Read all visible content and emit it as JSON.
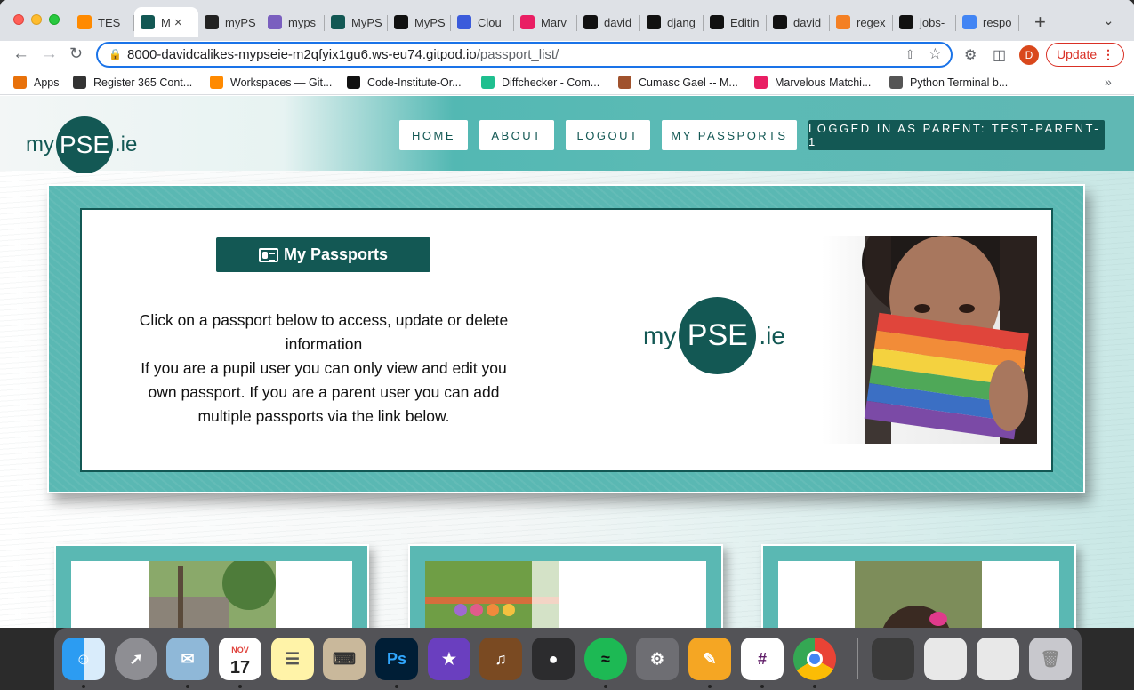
{
  "browser": {
    "tabs": [
      {
        "label": "TES",
        "favicon": "gitpod-icon",
        "color": "#ff8a00"
      },
      {
        "label": "M",
        "favicon": "mypse-icon",
        "color": "#135854",
        "active": true
      },
      {
        "label": "myPS",
        "favicon": "app-icon",
        "color": "#222"
      },
      {
        "label": "myps",
        "favicon": "heroku-icon",
        "color": "#7a5fbf"
      },
      {
        "label": "MyPS",
        "favicon": "mypse-icon",
        "color": "#135854"
      },
      {
        "label": "MyPS",
        "favicon": "github-icon",
        "color": "#111"
      },
      {
        "label": "Clou",
        "favicon": "cloud-icon",
        "color": "#3b5bdb"
      },
      {
        "label": "Marv",
        "favicon": "marvel-icon",
        "color": "#e91e63"
      },
      {
        "label": "david",
        "favicon": "github-icon",
        "color": "#111"
      },
      {
        "label": "djang",
        "favicon": "github-icon",
        "color": "#111"
      },
      {
        "label": "Editin",
        "favicon": "github-icon",
        "color": "#111"
      },
      {
        "label": "david",
        "favicon": "github-icon",
        "color": "#111"
      },
      {
        "label": "regex",
        "favicon": "stackoverflow-icon",
        "color": "#f48024"
      },
      {
        "label": "jobs-",
        "favicon": "github-icon",
        "color": "#111"
      },
      {
        "label": "respo",
        "favicon": "google-icon",
        "color": "#4285f4"
      }
    ],
    "url_host": "8000-davidcalikes-mypseie-m2qfyix1gu6.ws-eu74.gitpod.io",
    "url_path": "/passport_list/",
    "avatar_letter": "D",
    "update_label": "Update",
    "bookmarks": [
      {
        "label": "Apps",
        "icon": "apps-grid-icon",
        "color": "#e8710a"
      },
      {
        "label": "Register 365 Cont...",
        "icon": "register-icon",
        "color": "#333"
      },
      {
        "label": "Workspaces — Git...",
        "icon": "gitpod-icon",
        "color": "#ff8a00"
      },
      {
        "label": "Code-Institute-Or...",
        "icon": "github-icon",
        "color": "#111"
      },
      {
        "label": "Diffchecker - Com...",
        "icon": "diffchecker-icon",
        "color": "#1fbf8f"
      },
      {
        "label": "Cumasc Gael -- M...",
        "icon": "banjo-icon",
        "color": "#a0522d"
      },
      {
        "label": "Marvelous Matchi...",
        "icon": "marvel-icon",
        "color": "#e91e63"
      },
      {
        "label": "Python Terminal b...",
        "icon": "globe-icon",
        "color": "#555"
      }
    ]
  },
  "site": {
    "logo": {
      "pre": "my",
      "mid": "PSE",
      "post": ".ie"
    },
    "nav": [
      "HOME",
      "ABOUT",
      "LOGOUT",
      "MY PASSPORTS"
    ],
    "logged_in": "LOGGED IN AS PARENT: TEST-PARENT-1",
    "hero": {
      "button_label": "My Passports",
      "intro_line1": "Click on a passport below to access, update or delete information",
      "intro_line2": "If you are a pupil user you can only view and edit you own passport. If you are a parent user you can add multiple passports via the link below."
    }
  },
  "colors": {
    "brand": "#135854",
    "teal": "#5ab8b3"
  },
  "dock": {
    "calendar_month": "NOV",
    "calendar_day": "17",
    "apps": [
      "Finder",
      "Launchpad",
      "Mail",
      "Calendar",
      "Notes",
      "Script Editor",
      "Photoshop",
      "iMovie",
      "GarageBand",
      "Logic Pro",
      "Spotify",
      "System Preferences",
      "Pages",
      "Slack",
      "Chrome"
    ]
  }
}
